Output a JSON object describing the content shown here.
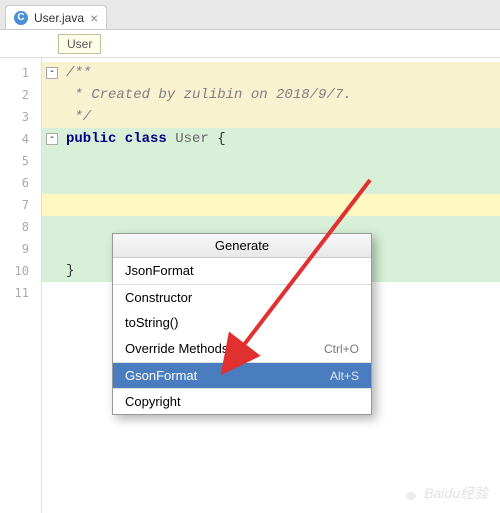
{
  "tab": {
    "icon_letter": "C",
    "label": "User.java",
    "close_glyph": "×"
  },
  "breadcrumb": {
    "class": "User"
  },
  "lines": [
    {
      "n": "1",
      "cls": "doc-bg",
      "spans": [
        {
          "c": "comment",
          "t": "/**"
        }
      ],
      "fold": true
    },
    {
      "n": "2",
      "cls": "doc-bg",
      "spans": [
        {
          "c": "comment",
          "t": " * Created by zulibin on 2018/9/7."
        }
      ]
    },
    {
      "n": "3",
      "cls": "doc-bg",
      "spans": [
        {
          "c": "comment",
          "t": " */"
        }
      ]
    },
    {
      "n": "4",
      "cls": "class-bg",
      "spans": [
        {
          "c": "kw",
          "t": "public class "
        },
        {
          "c": "cls",
          "t": "User "
        },
        {
          "c": "brace",
          "t": "{"
        }
      ],
      "fold": true
    },
    {
      "n": "5",
      "cls": "class-bg",
      "spans": []
    },
    {
      "n": "6",
      "cls": "class-bg",
      "spans": []
    },
    {
      "n": "7",
      "cls": "highlight-bg",
      "spans": []
    },
    {
      "n": "8",
      "cls": "class-bg",
      "spans": []
    },
    {
      "n": "9",
      "cls": "class-bg",
      "spans": []
    },
    {
      "n": "10",
      "cls": "class-bg",
      "spans": [
        {
          "c": "brace",
          "t": "}"
        }
      ]
    },
    {
      "n": "11",
      "cls": "",
      "spans": []
    }
  ],
  "popup": {
    "title": "Generate",
    "items": [
      {
        "label": "JsonFormat",
        "shortcut": "",
        "sep": false,
        "selected": false
      },
      {
        "label": "Constructor",
        "shortcut": "",
        "sep": true,
        "selected": false
      },
      {
        "label": "toString()",
        "shortcut": "",
        "sep": false,
        "selected": false
      },
      {
        "label": "Override Methods...",
        "shortcut": "Ctrl+O",
        "sep": false,
        "selected": false
      },
      {
        "label": "GsonFormat",
        "shortcut": "Alt+S",
        "sep": true,
        "selected": true
      },
      {
        "label": "Copyright",
        "shortcut": "",
        "sep": true,
        "selected": false
      }
    ]
  },
  "arrow_color": "#e03030",
  "watermark": "Baidu经验"
}
